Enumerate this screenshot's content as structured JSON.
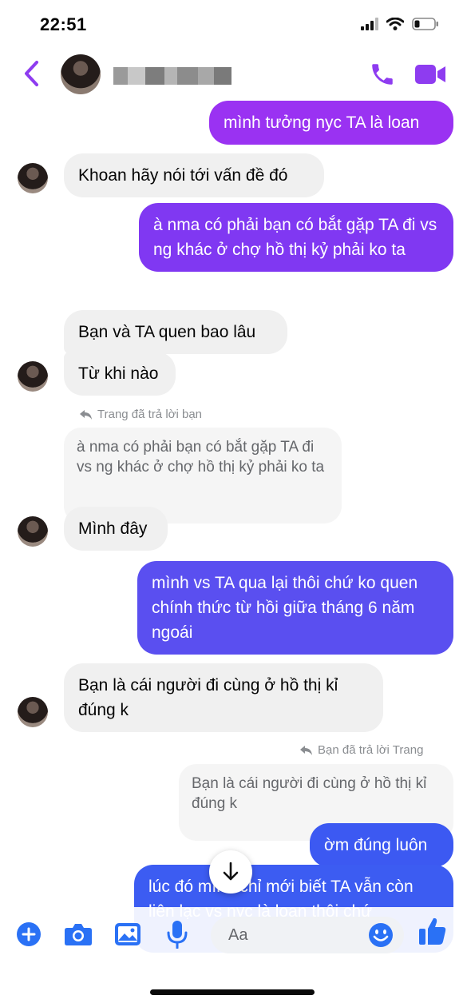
{
  "status": {
    "time": "22:51"
  },
  "header": {
    "contact_name": ""
  },
  "messages": [
    {
      "side": "out",
      "text": "mình tưởng nyc TA là loan"
    },
    {
      "side": "in",
      "text": "Khoan hãy nói tới vấn đề đó"
    },
    {
      "side": "out",
      "text": "à nma có phải bạn có bắt gặp TA đi vs ng khác ở chợ hồ thị kỷ phải ko ta"
    },
    {
      "side": "in",
      "text": "Bạn và TA quen bao lâu"
    },
    {
      "side": "in",
      "text": "Từ khi nào"
    },
    {
      "side": "in",
      "text": "Mình đây"
    },
    {
      "side": "out",
      "text": "mình vs TA qua lại thôi chứ ko quen chính thức từ hồi giữa tháng 6 năm ngoái"
    },
    {
      "side": "in",
      "text": "Bạn là cái người đi cùng ở hồ thị kỉ đúng k"
    },
    {
      "side": "out",
      "text": "ờm đúng luôn"
    },
    {
      "side": "out",
      "text": "lúc đó mình chỉ mới biết TA vẫn còn liên lạc vs nyc là loan thôi chứ"
    }
  ],
  "replies": [
    {
      "label": "Trang đã trả lời bạn",
      "quote": "à nma có phải bạn có bắt gặp TA đi vs ng khác ở chợ hồ thị kỷ phải ko ta"
    },
    {
      "label": "Bạn đã trả lời Trang",
      "quote": "Bạn là cái người đi cùng ở hồ thị kỉ đúng k"
    }
  ],
  "composer": {
    "placeholder": "Aa"
  },
  "icons": {
    "back": "chevron-left-icon",
    "call": "phone-icon",
    "video": "video-camera-icon",
    "plus": "plus-circle-icon",
    "camera": "camera-icon",
    "gallery": "image-icon",
    "mic": "microphone-icon",
    "emoji": "emoji-icon",
    "like": "thumbs-up-icon",
    "scroll": "arrow-down-icon",
    "reply": "reply-arrow-icon"
  },
  "colors": {
    "accent": "#8e3cf0",
    "bubble_purple_light": "#9a32f2",
    "bubble_purple": "#7b3ff0",
    "bubble_blue": "#4f52f0",
    "bubble_blue_deep": "#3c59f2",
    "composer_blue": "#2a71f5",
    "incoming": "#f0f0f0"
  }
}
